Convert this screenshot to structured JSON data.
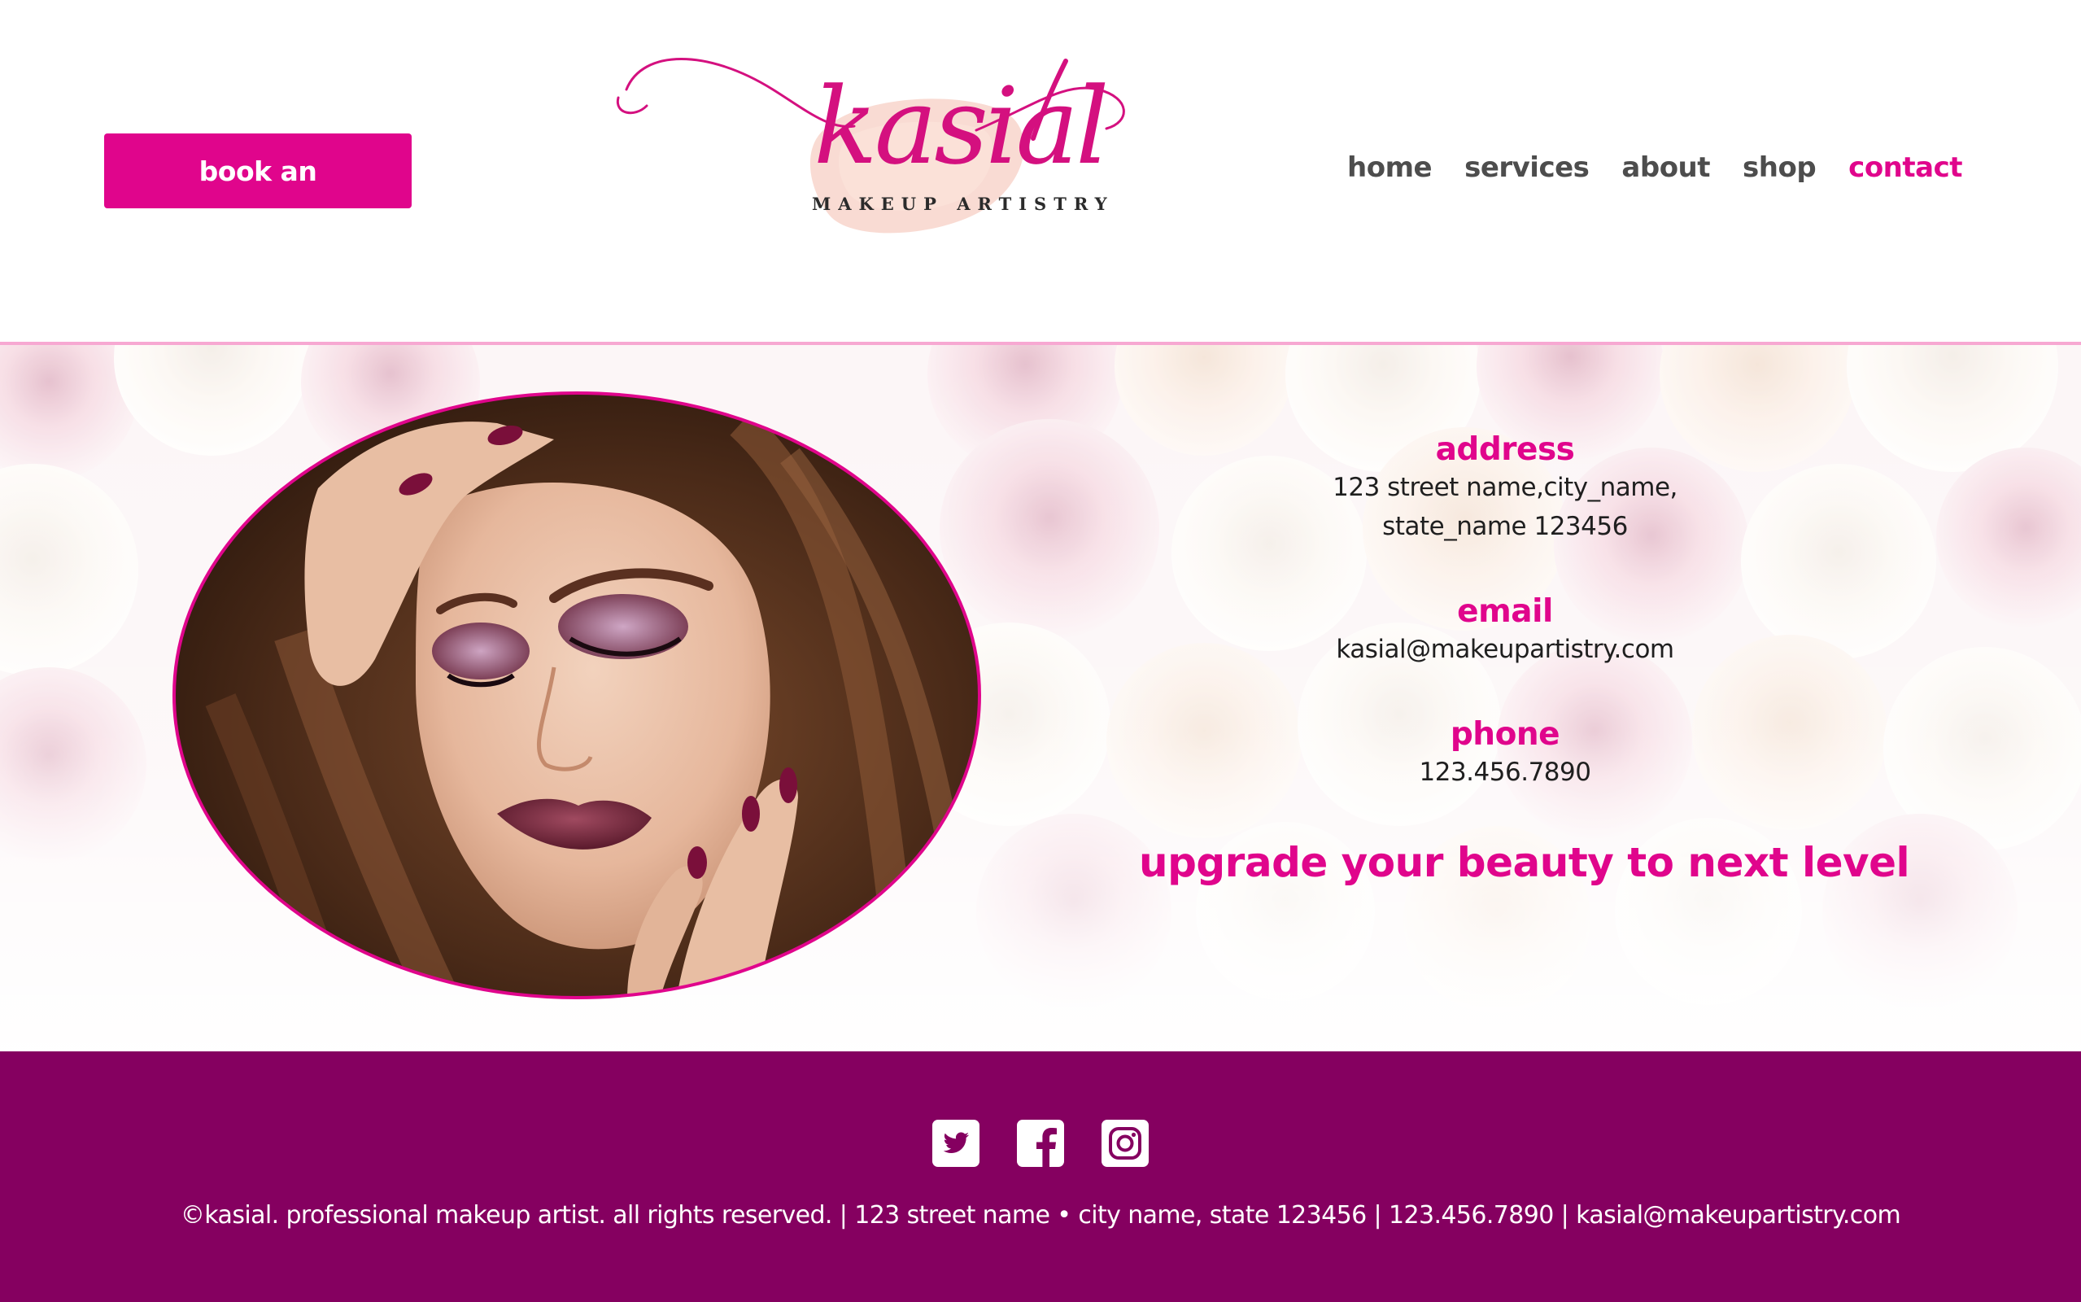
{
  "header": {
    "book_button": "book an appointment",
    "logo": {
      "name": "kasial",
      "tagline": "MAKEUP ARTISTRY"
    },
    "nav": [
      {
        "label": "home",
        "active": false
      },
      {
        "label": "services",
        "active": false
      },
      {
        "label": "about",
        "active": false
      },
      {
        "label": "shop",
        "active": false
      },
      {
        "label": "contact",
        "active": true
      }
    ]
  },
  "contact": {
    "address_heading": "address",
    "address_line1": "123 street name,city_name,",
    "address_line2": "state_name 123456",
    "email_heading": "email",
    "email_value": "kasial@makeupartistry.com",
    "phone_heading": "phone",
    "phone_value": "123.456.7890",
    "tagline": "upgrade your beauty to next level"
  },
  "portrait": {
    "icon": "woman-makeup-portrait-image"
  },
  "footer": {
    "social_icons": [
      "twitter-icon",
      "facebook-icon",
      "instagram-icon"
    ],
    "text": "©kasial. professional makeup artist. all rights reserved. | 123 street name • city name, state 123456 | 123.456.7890 | kasial@makeupartistry.com"
  },
  "colors": {
    "accent": "#e0058c",
    "footer_bg": "#850060",
    "nav_text": "#4d4d4d"
  }
}
